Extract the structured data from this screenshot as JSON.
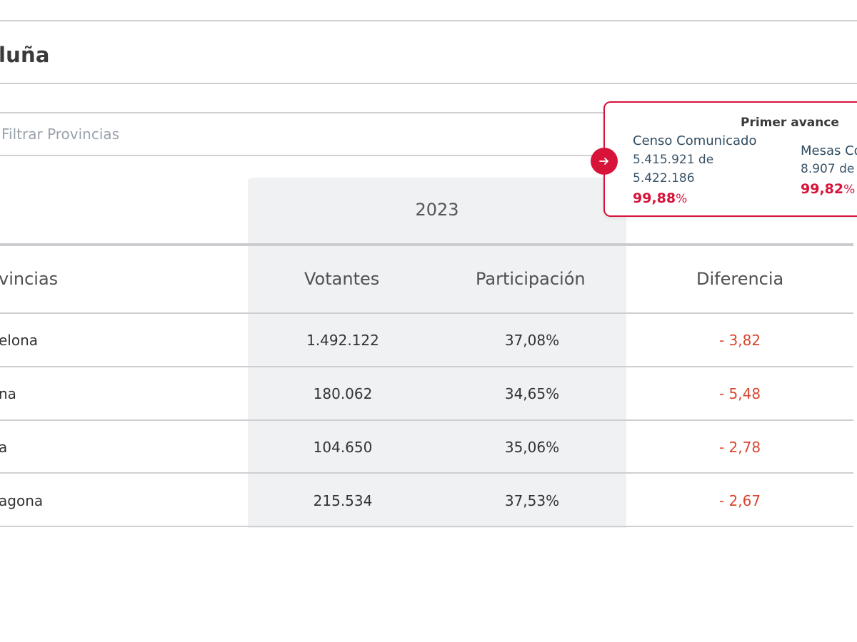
{
  "header": {
    "title": "luña"
  },
  "filter": {
    "placeholder": "Filtrar Provincias"
  },
  "table": {
    "year": "2023",
    "columns": {
      "provincias": "vincias",
      "votantes": "Votantes",
      "participacion": "Participación",
      "diferencia": "Diferencia"
    },
    "rows": [
      {
        "provincia": "elona",
        "votantes": "1.492.122",
        "participacion": "37,08%",
        "diferencia": "- 3,82"
      },
      {
        "provincia": "na",
        "votantes": "180.062",
        "participacion": "34,65%",
        "diferencia": "- 5,48"
      },
      {
        "provincia": "a",
        "votantes": "104.650",
        "participacion": "35,06%",
        "diferencia": "- 2,78"
      },
      {
        "provincia": "agona",
        "votantes": "215.534",
        "participacion": "37,53%",
        "diferencia": "- 2,67"
      }
    ]
  },
  "avance": {
    "title": "Primer avance",
    "censo": {
      "label": "Censo Comunicado",
      "line1": "5.415.921 de",
      "line2": "5.422.186",
      "pct": "99,88",
      "pct_sign": "%"
    },
    "mesas": {
      "label": "Mesas Co",
      "line1": "8.907 de",
      "pct": "99,82",
      "pct_sign": "%"
    }
  },
  "colors": {
    "accent": "#d7133a",
    "diff": "#d9462f",
    "column_bg": "#f0f1f3"
  },
  "icons": {
    "arrow": "arrow-right-icon"
  }
}
